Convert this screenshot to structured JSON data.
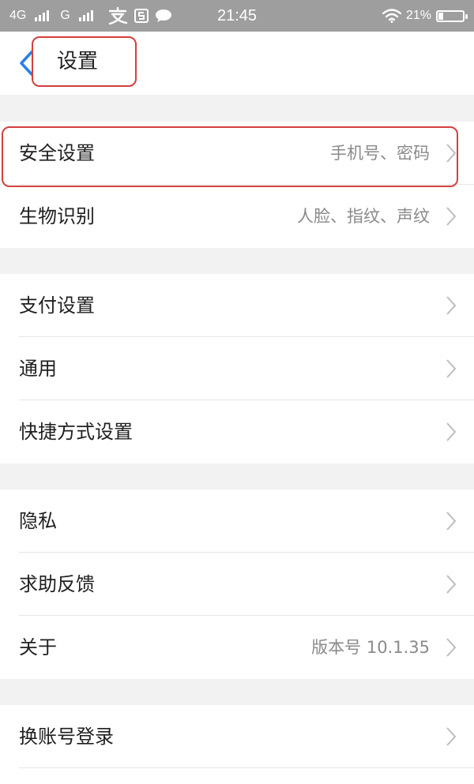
{
  "status_bar": {
    "network1": "4G",
    "network2": "G",
    "time": "21:45",
    "battery_percent": "21%",
    "battery_level": 0.21
  },
  "navbar": {
    "title": "设置"
  },
  "groups": [
    {
      "items": [
        {
          "label": "安全设置",
          "value": "手机号、密码"
        },
        {
          "label": "生物识别",
          "value": "人脸、指纹、声纹"
        }
      ]
    },
    {
      "items": [
        {
          "label": "支付设置"
        },
        {
          "label": "通用"
        },
        {
          "label": "快捷方式设置"
        }
      ]
    },
    {
      "items": [
        {
          "label": "隐私"
        },
        {
          "label": "求助反馈"
        },
        {
          "label": "关于",
          "value": "版本号 10.1.35"
        }
      ]
    },
    {
      "items": [
        {
          "label": "换账号登录"
        }
      ]
    }
  ],
  "colors": {
    "accent": "#2a7ee8",
    "highlight": "#d3403f"
  }
}
